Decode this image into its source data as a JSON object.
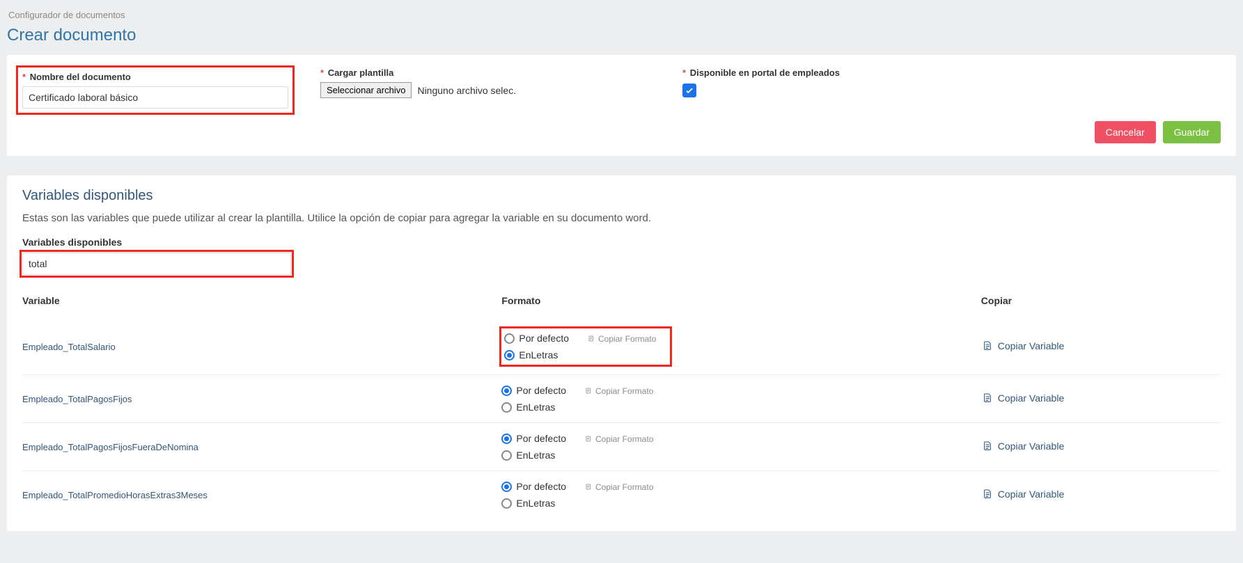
{
  "breadcrumb": "Configurador de documentos",
  "page_title": "Crear documento",
  "form": {
    "name_label": "Nombre del documento",
    "name_value": "Certificado laboral básico",
    "upload_label": "Cargar plantilla",
    "upload_btn": "Seleccionar archivo",
    "upload_status": "Ninguno archivo selec.",
    "portal_label": "Disponible en portal de empleados",
    "portal_checked": true,
    "cancel": "Cancelar",
    "save": "Guardar"
  },
  "vars_section": {
    "title": "Variables disponibles",
    "desc": "Estas son las variables que puede utilizar al crear la plantilla. Utilice la opción de copiar para agregar la variable en su documento word.",
    "filter_label": "Variables disponibles",
    "filter_value": "total"
  },
  "table": {
    "headers": {
      "variable": "Variable",
      "format": "Formato",
      "copy": "Copiar"
    },
    "fmt_default": "Por defecto",
    "fmt_letters": "EnLetras",
    "copy_fmt": "Copiar Formato",
    "copy_var": "Copiar Variable",
    "rows": [
      {
        "name": "Empleado_TotalSalario",
        "selected": "letters",
        "highlight": true
      },
      {
        "name": "Empleado_TotalPagosFijos",
        "selected": "default",
        "highlight": false
      },
      {
        "name": "Empleado_TotalPagosFijosFueraDeNomina",
        "selected": "default",
        "highlight": false
      },
      {
        "name": "Empleado_TotalPromedioHorasExtras3Meses",
        "selected": "default",
        "highlight": false
      }
    ]
  }
}
